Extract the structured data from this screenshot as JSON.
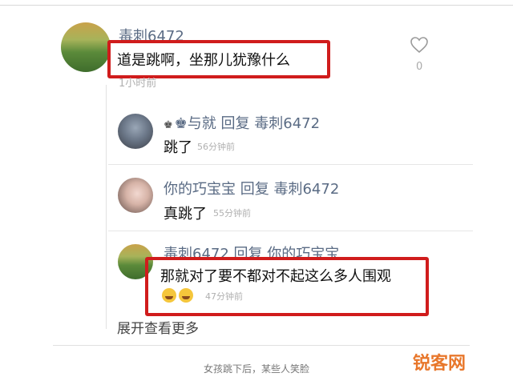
{
  "main_comment": {
    "author": "毒刺6472",
    "text": "道是跳啊，坐那儿犹豫什么",
    "time": "1小时前",
    "like_count": "0"
  },
  "replies": [
    {
      "author": "♚与就",
      "reply_word": "回复",
      "target": "毒刺6472",
      "text": "跳了",
      "time": "56分钟前"
    },
    {
      "author": "你的巧宝宝",
      "reply_word": "回复",
      "target": "毒刺6472",
      "text": "真跳了",
      "time": "55分钟前"
    },
    {
      "author": "毒刺6472",
      "reply_word": "回复",
      "target": "你的巧宝宝",
      "text": "那就对了要不都对不起这么多人围观",
      "time": "47分钟前"
    }
  ],
  "expand_more": "展开查看更多",
  "caption": "女孩跳下后，某些人笑脸",
  "watermark": "锐客网",
  "colors": {
    "highlight": "#d01c1c",
    "name": "#5a6b84",
    "watermark": "#e8772b"
  },
  "icons": [
    "heart-icon",
    "crown-icon",
    "laughing-emoji-icon"
  ]
}
